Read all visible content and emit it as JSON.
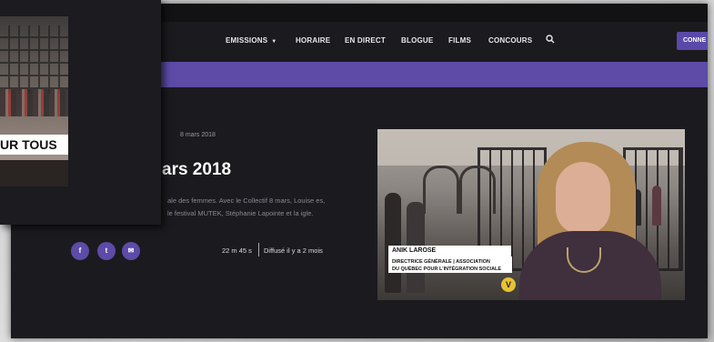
{
  "nav": {
    "items": [
      {
        "label": "EMISSIONS",
        "has_caret": true
      },
      {
        "label": "HORAIRE"
      },
      {
        "label": "EN DIRECT"
      },
      {
        "label": "BLOGUE"
      },
      {
        "label": "FILMS"
      },
      {
        "label": "CONCOURS"
      }
    ],
    "search_icon": "search-icon",
    "login_label": "CONNE"
  },
  "article": {
    "date": "8 mars 2018",
    "title": "ars 2018",
    "description": "ale des femmes. Avec le Collectif 8 mars, Louise es, le festival MUTEK, Stéphanie Lapointe et la igle.",
    "duration": "22 m 45 s",
    "aired": "Diffusé il y a 2 mois"
  },
  "share": {
    "facebook": "f",
    "twitter": "t",
    "email": "✉"
  },
  "video": {
    "lower_third_name": "ANIK LAROSE",
    "lower_third_line1": "DIRECTRICE GÉNÉRALE | ASSOCIATION",
    "lower_third_line2": "DU QUÉBEC POUR L'INTÉGRATION SOCIALE",
    "channel_logo_glyph": "V"
  },
  "popup": {
    "caption": "UR TOUS"
  },
  "colors": {
    "accent": "#5d4ba7",
    "background": "#1b1a1e"
  }
}
